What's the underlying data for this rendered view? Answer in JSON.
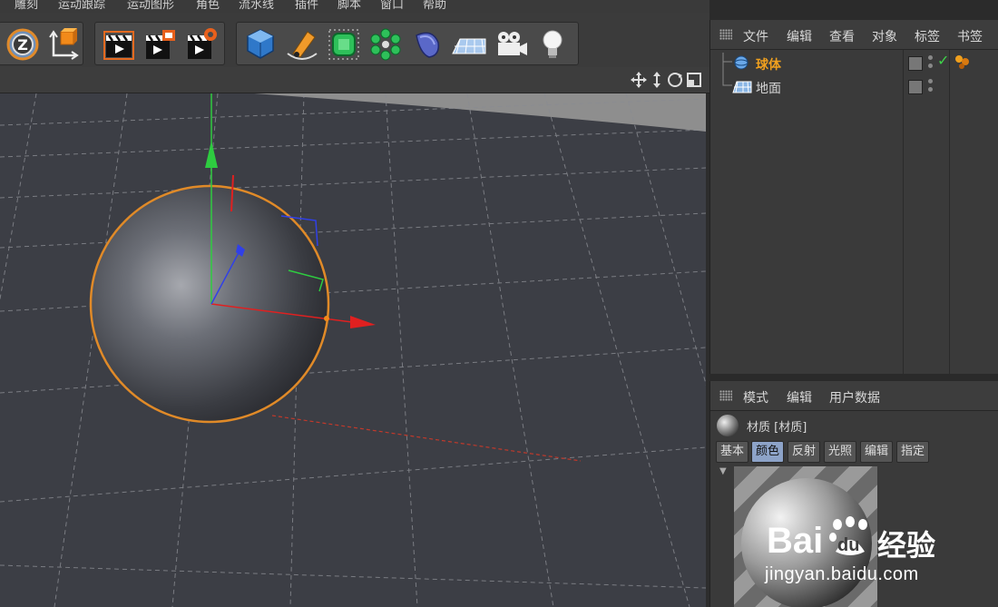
{
  "menubar": [
    "雕刻",
    "运动跟踪",
    "运动图形",
    "角色",
    "流水线",
    "插件",
    "脚本",
    "窗口",
    "帮助"
  ],
  "toolbar": {
    "groups": [
      {
        "name": "axis-mode-group",
        "icons": [
          "z-lock-icon",
          "coordinate-axis-icon"
        ]
      },
      {
        "name": "render-group",
        "icons": [
          "render-view-icon",
          "render-picture-viewer-icon",
          "render-settings-icon"
        ]
      },
      {
        "name": "create-group",
        "icons": [
          "cube-icon",
          "pen-spline-icon",
          "subdivision-surface-icon",
          "cloner-icon",
          "deformer-icon",
          "floor-icon",
          "camera-icon",
          "light-icon"
        ]
      }
    ]
  },
  "object_manager": {
    "menu": [
      "文件",
      "编辑",
      "查看",
      "对象",
      "标签",
      "书签"
    ],
    "objects": [
      {
        "name": "球体",
        "selected": true,
        "icon": "sphere-icon",
        "checked": true
      },
      {
        "name": "地面",
        "selected": false,
        "icon": "floor-icon",
        "checked": false
      }
    ],
    "colors": {
      "selected": "#f0a01e",
      "normal": "#d6d6d6"
    }
  },
  "attribute_manager": {
    "menu": [
      "模式",
      "编辑",
      "用户数据"
    ],
    "material_title": "材质 [材质]",
    "tabs": [
      {
        "label": "基本",
        "active": false
      },
      {
        "label": "颜色",
        "active": true
      },
      {
        "label": "反射",
        "active": false
      },
      {
        "label": "光照",
        "active": false
      },
      {
        "label": "编辑",
        "active": false
      },
      {
        "label": "指定",
        "active": false
      }
    ]
  },
  "watermark": {
    "brand": "Bai",
    "brand_suffix": "du",
    "cn": "经验",
    "url": "jingyan.baidu.com"
  }
}
